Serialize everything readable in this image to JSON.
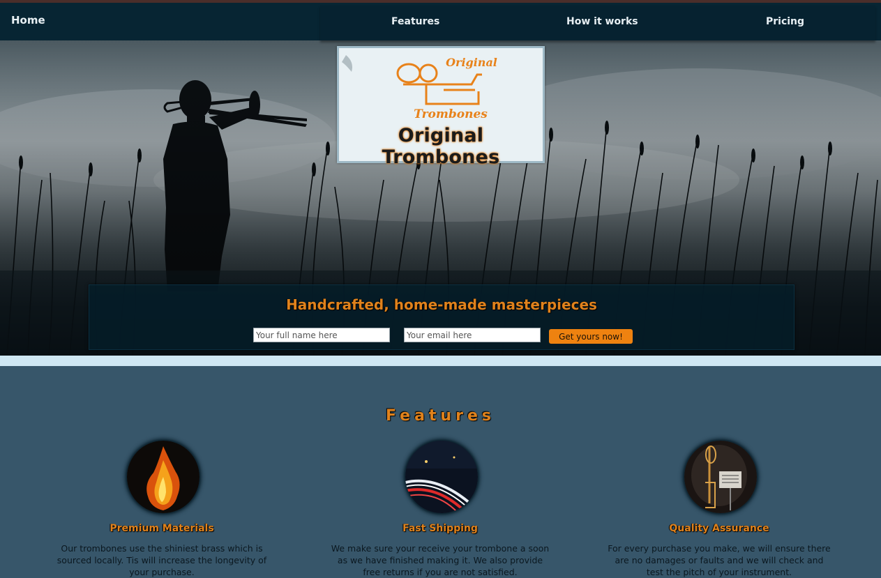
{
  "nav": {
    "home": "Home",
    "items": [
      "Features",
      "How it works",
      "Pricing"
    ]
  },
  "brand": {
    "logo_text_line1": "Original",
    "logo_text_line2": "Trombones",
    "title": "Original Trombones"
  },
  "cta": {
    "headline": "Handcrafted, home-made masterpieces",
    "name_placeholder": "Your full name here",
    "email_placeholder": "Your email here",
    "button_label": "Get yours now!"
  },
  "features": {
    "heading": "Features",
    "items": [
      {
        "title": "Premium Materials",
        "text": "Our trombones use the shiniest brass which is sourced locally. Tis will increase the longevity of your purchase.",
        "image": "fire-image"
      },
      {
        "title": "Fast Shipping",
        "text": "We make sure your receive your trombone a soon as we have finished making it. We also provide free returns if you are not satisfied.",
        "image": "highway-lights-image"
      },
      {
        "title": "Quality Assurance",
        "text": "For every purchase you make, we will ensure there are no damages or faults and we will check and test the pitch of your instrument.",
        "image": "trombone-stand-image"
      }
    ]
  },
  "colors": {
    "accent_orange": "#e0821c",
    "nav_bg": "#072533",
    "page_bg": "#37566a",
    "strip": "#cfe7f3"
  }
}
